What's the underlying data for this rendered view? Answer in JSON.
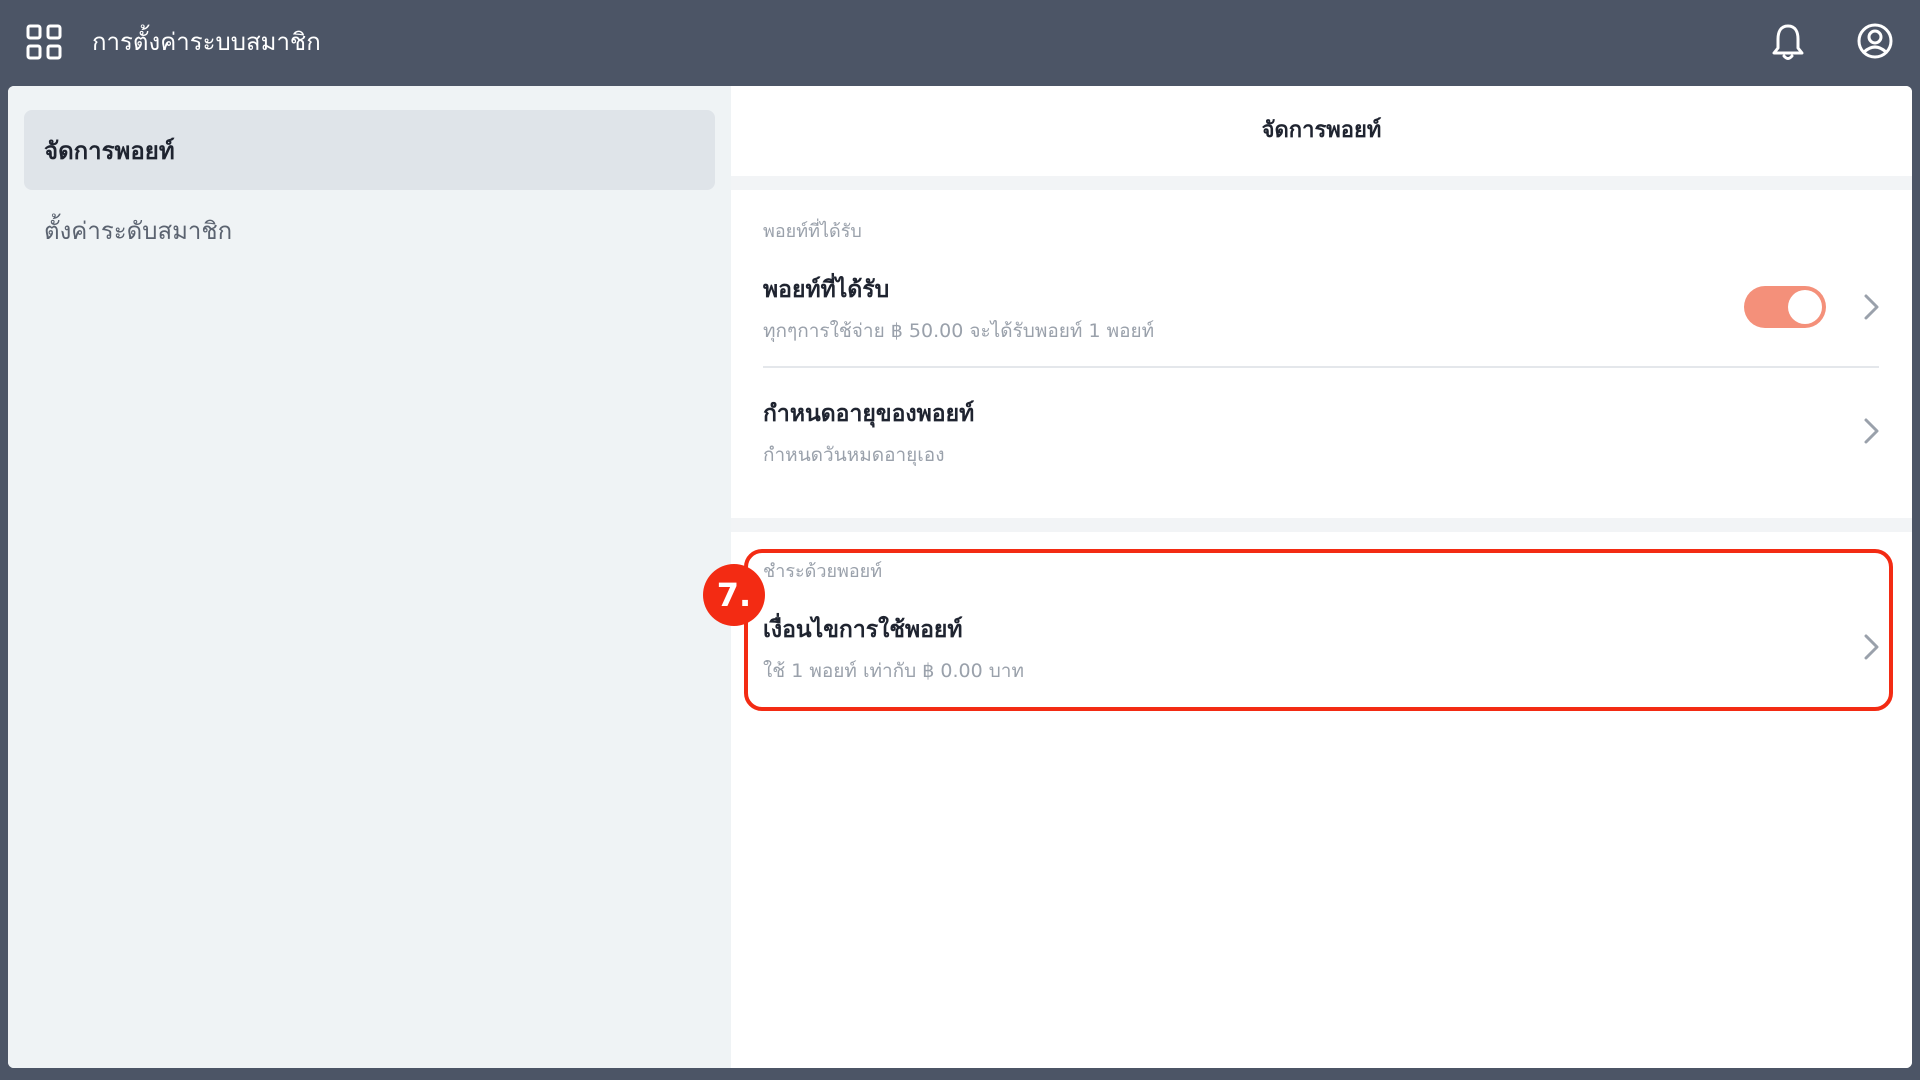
{
  "topbar": {
    "title": "การตั้งค่าระบบสมาชิก",
    "apps_icon": "grid-apps-icon",
    "bell_icon": "bell-icon",
    "user_icon": "user-circle-icon"
  },
  "sidebar": {
    "items": [
      {
        "label": "จัดการพอยท์",
        "active": true
      },
      {
        "label": "ตั้งค่าระดับสมาชิก",
        "active": false
      }
    ]
  },
  "main": {
    "header": "จัดการพอยท์",
    "section1": {
      "label": "พอยท์ที่ได้รับ",
      "rows": [
        {
          "title": "พอยท์ที่ได้รับ",
          "subtitle": "ทุกๆการใช้จ่าย ฿ 50.00 จะได้รับพอยท์ 1 พอยท์",
          "toggle_on": true
        },
        {
          "title": "กำหนดอายุของพอยท์",
          "subtitle": "กำหนดวันหมดอายุเอง"
        }
      ]
    },
    "section2": {
      "label": "ชำระด้วยพอยท์",
      "rows": [
        {
          "title": "เงื่อนไขการใช้พอยท์",
          "subtitle": "ใช้ 1 พอยท์ เท่ากับ ฿ 0.00 บาท"
        }
      ]
    }
  },
  "annotation": {
    "step": "7.",
    "color": "#f32b13"
  },
  "colors": {
    "topbar": "#4c5566",
    "toggle_on": "#f4907a"
  }
}
